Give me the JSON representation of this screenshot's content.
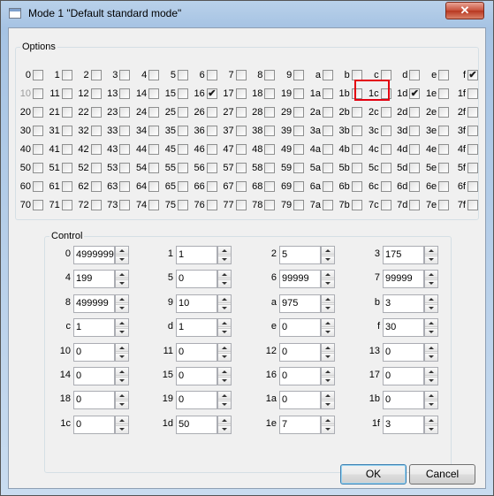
{
  "window": {
    "title": "Mode 1 \"Default standard mode\"",
    "close_symbol": "✕"
  },
  "options": {
    "title": "Options",
    "rows": [
      [
        {
          "label": "0"
        },
        {
          "label": "1"
        },
        {
          "label": "2"
        },
        {
          "label": "3"
        },
        {
          "label": "4"
        },
        {
          "label": "5"
        },
        {
          "label": "6"
        },
        {
          "label": "7"
        },
        {
          "label": "8"
        },
        {
          "label": "9"
        },
        {
          "label": "a"
        },
        {
          "label": "b"
        },
        {
          "label": "c"
        },
        {
          "label": "d"
        },
        {
          "label": "e"
        },
        {
          "label": "f",
          "checked": true
        }
      ],
      [
        {
          "label": "10",
          "dim": true
        },
        {
          "label": "11"
        },
        {
          "label": "12"
        },
        {
          "label": "13"
        },
        {
          "label": "14"
        },
        {
          "label": "15"
        },
        {
          "label": "16",
          "checked": true
        },
        {
          "label": "17"
        },
        {
          "label": "18"
        },
        {
          "label": "19"
        },
        {
          "label": "1a"
        },
        {
          "label": "1b"
        },
        {
          "label": "1c",
          "highlight": true
        },
        {
          "label": "1d",
          "checked": true
        },
        {
          "label": "1e"
        },
        {
          "label": "1f"
        }
      ],
      [
        {
          "label": "20"
        },
        {
          "label": "21"
        },
        {
          "label": "22"
        },
        {
          "label": "23"
        },
        {
          "label": "24"
        },
        {
          "label": "25"
        },
        {
          "label": "26"
        },
        {
          "label": "27"
        },
        {
          "label": "28"
        },
        {
          "label": "29"
        },
        {
          "label": "2a"
        },
        {
          "label": "2b"
        },
        {
          "label": "2c"
        },
        {
          "label": "2d"
        },
        {
          "label": "2e"
        },
        {
          "label": "2f"
        }
      ],
      [
        {
          "label": "30"
        },
        {
          "label": "31"
        },
        {
          "label": "32"
        },
        {
          "label": "33"
        },
        {
          "label": "34"
        },
        {
          "label": "35"
        },
        {
          "label": "36"
        },
        {
          "label": "37"
        },
        {
          "label": "38"
        },
        {
          "label": "39"
        },
        {
          "label": "3a"
        },
        {
          "label": "3b"
        },
        {
          "label": "3c"
        },
        {
          "label": "3d"
        },
        {
          "label": "3e"
        },
        {
          "label": "3f"
        }
      ],
      [
        {
          "label": "40"
        },
        {
          "label": "41"
        },
        {
          "label": "42"
        },
        {
          "label": "43"
        },
        {
          "label": "44"
        },
        {
          "label": "45"
        },
        {
          "label": "46"
        },
        {
          "label": "47"
        },
        {
          "label": "48"
        },
        {
          "label": "49"
        },
        {
          "label": "4a"
        },
        {
          "label": "4b"
        },
        {
          "label": "4c"
        },
        {
          "label": "4d"
        },
        {
          "label": "4e"
        },
        {
          "label": "4f"
        }
      ],
      [
        {
          "label": "50"
        },
        {
          "label": "51"
        },
        {
          "label": "52"
        },
        {
          "label": "53"
        },
        {
          "label": "54"
        },
        {
          "label": "55"
        },
        {
          "label": "56"
        },
        {
          "label": "57"
        },
        {
          "label": "58"
        },
        {
          "label": "59"
        },
        {
          "label": "5a"
        },
        {
          "label": "5b"
        },
        {
          "label": "5c"
        },
        {
          "label": "5d"
        },
        {
          "label": "5e"
        },
        {
          "label": "5f"
        }
      ],
      [
        {
          "label": "60"
        },
        {
          "label": "61"
        },
        {
          "label": "62"
        },
        {
          "label": "63"
        },
        {
          "label": "64"
        },
        {
          "label": "65"
        },
        {
          "label": "66"
        },
        {
          "label": "67"
        },
        {
          "label": "68"
        },
        {
          "label": "69"
        },
        {
          "label": "6a"
        },
        {
          "label": "6b"
        },
        {
          "label": "6c"
        },
        {
          "label": "6d"
        },
        {
          "label": "6e"
        },
        {
          "label": "6f"
        }
      ],
      [
        {
          "label": "70"
        },
        {
          "label": "71"
        },
        {
          "label": "72"
        },
        {
          "label": "73"
        },
        {
          "label": "74"
        },
        {
          "label": "75"
        },
        {
          "label": "76"
        },
        {
          "label": "77"
        },
        {
          "label": "78"
        },
        {
          "label": "79"
        },
        {
          "label": "7a"
        },
        {
          "label": "7b"
        },
        {
          "label": "7c"
        },
        {
          "label": "7d"
        },
        {
          "label": "7e"
        },
        {
          "label": "7f"
        }
      ]
    ]
  },
  "control": {
    "title": "Control",
    "fields": [
      {
        "label": "0",
        "value": "4999999"
      },
      {
        "label": "1",
        "value": "1"
      },
      {
        "label": "2",
        "value": "5"
      },
      {
        "label": "3",
        "value": "175"
      },
      {
        "label": "4",
        "value": "199"
      },
      {
        "label": "5",
        "value": "0"
      },
      {
        "label": "6",
        "value": "99999"
      },
      {
        "label": "7",
        "value": "99999"
      },
      {
        "label": "8",
        "value": "499999"
      },
      {
        "label": "9",
        "value": "10"
      },
      {
        "label": "a",
        "value": "975"
      },
      {
        "label": "b",
        "value": "3"
      },
      {
        "label": "c",
        "value": "1"
      },
      {
        "label": "d",
        "value": "1"
      },
      {
        "label": "e",
        "value": "0"
      },
      {
        "label": "f",
        "value": "30"
      },
      {
        "label": "10",
        "value": "0"
      },
      {
        "label": "11",
        "value": "0"
      },
      {
        "label": "12",
        "value": "0"
      },
      {
        "label": "13",
        "value": "0"
      },
      {
        "label": "14",
        "value": "0"
      },
      {
        "label": "15",
        "value": "0"
      },
      {
        "label": "16",
        "value": "0"
      },
      {
        "label": "17",
        "value": "0"
      },
      {
        "label": "18",
        "value": "0"
      },
      {
        "label": "19",
        "value": "0"
      },
      {
        "label": "1a",
        "value": "0"
      },
      {
        "label": "1b",
        "value": "0"
      },
      {
        "label": "1c",
        "value": "0"
      },
      {
        "label": "1d",
        "value": "50"
      },
      {
        "label": "1e",
        "value": "7"
      },
      {
        "label": "1f",
        "value": "3"
      }
    ]
  },
  "buttons": {
    "ok": "OK",
    "cancel": "Cancel"
  },
  "colors": {
    "highlight": "#e3000f",
    "title_bar": "#b9d1ea",
    "dialog_bg": "#f0f0f0"
  }
}
